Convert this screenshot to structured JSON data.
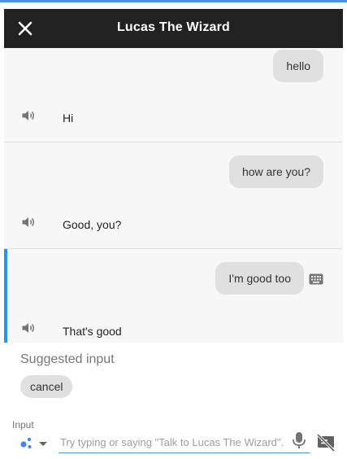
{
  "header": {
    "title": "Lucas The Wizard"
  },
  "conversation": [
    {
      "user": "hello",
      "reply": "Hi"
    },
    {
      "user": "how are you?",
      "reply": "Good, you?"
    },
    {
      "user": "I'm good too",
      "reply": "That's good"
    }
  ],
  "suggestions": {
    "label": "Suggested input",
    "chips": [
      "cancel"
    ]
  },
  "input": {
    "label": "Input",
    "placeholder": "Try typing or saying \"Talk to Lucas The Wizard\"."
  },
  "colors": {
    "accent": "#2196f3",
    "titlebar": "#212121",
    "bubble": "#e0e0e0"
  },
  "icons": {
    "close": "close-icon",
    "speaker": "speaker-icon",
    "keyboard": "keyboard-icon",
    "assistant": "assistant-dots-icon",
    "mic": "mic-icon",
    "no_display": "no-display-icon"
  }
}
